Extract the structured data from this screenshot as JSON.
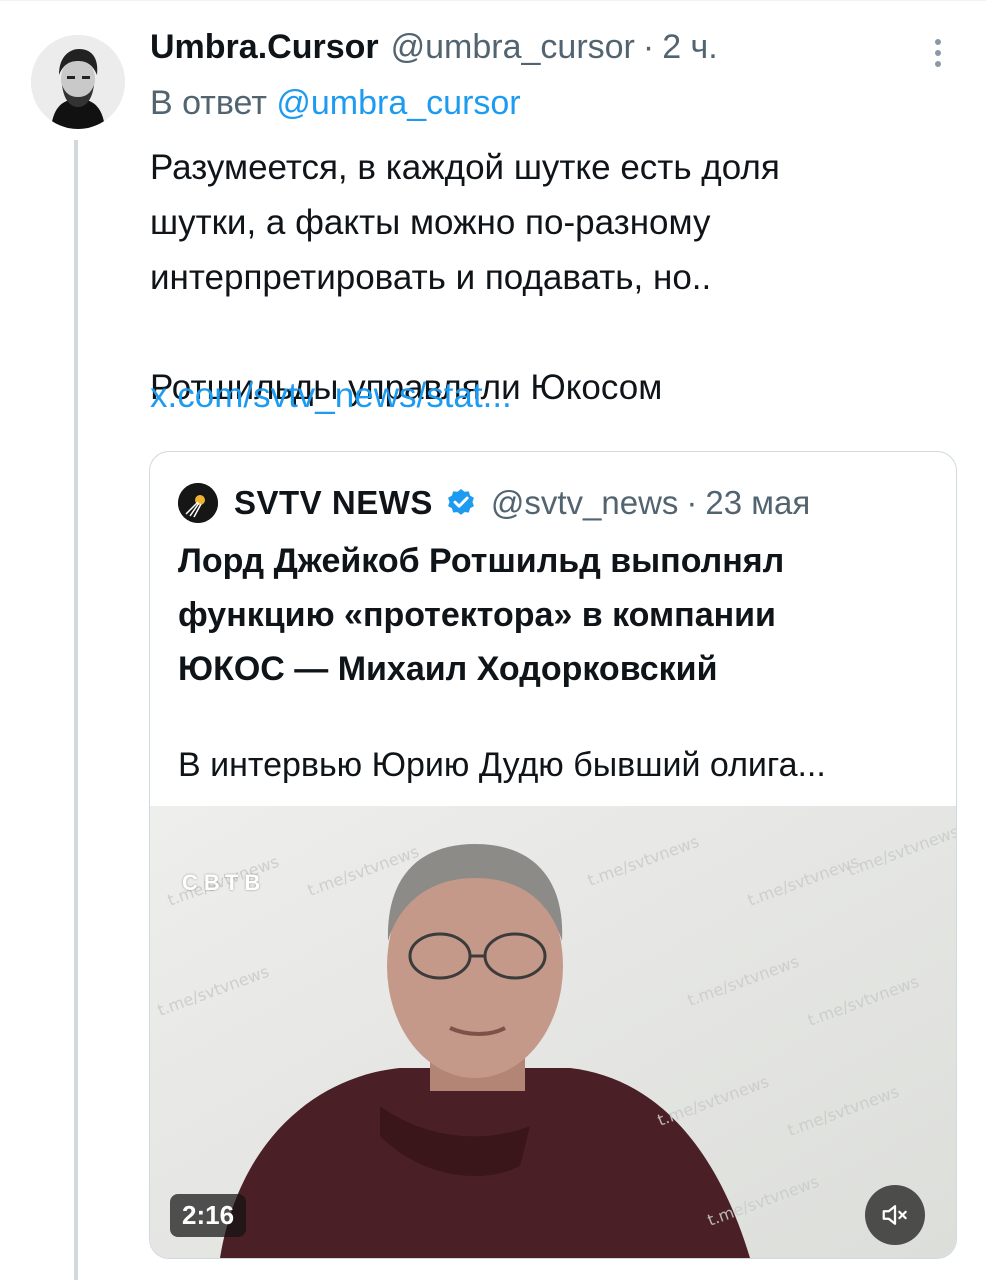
{
  "tweet": {
    "author_name": "Umbra.Cursor",
    "author_handle": "@umbra_cursor",
    "separator": "·",
    "time": "2 ч.",
    "reply_prefix": "В ответ",
    "reply_to": "@umbra_cursor",
    "text": "Разумеется, в каждой шутке есть доля\nшутки, а факты можно по-разному\nинтерпретировать и подавать, но..\n\nРотшильды управляли Юкосом",
    "link": "x.com/svtv_news/stat..."
  },
  "quote": {
    "name": "SVTV NEWS",
    "handle": "@svtv_news",
    "separator": "·",
    "time": "23 мая",
    "title": "Лорд Джейкоб Ротшильд выполнял\nфункцию «протектора» в компании\nЮКОС — Михаил Ходорковский",
    "excerpt": "В интервью Юрию Дудю бывший олига...",
    "video": {
      "duration": "2:16",
      "brand_mark": "СВТВ"
    },
    "verified_color": "#1d9bf0"
  },
  "icons": {
    "more": "more-vertical-icon",
    "verified": "verified-badge-icon",
    "mute": "volume-muted-icon"
  },
  "colors": {
    "accent": "#1d9bf0",
    "secondary_text": "#536471"
  }
}
